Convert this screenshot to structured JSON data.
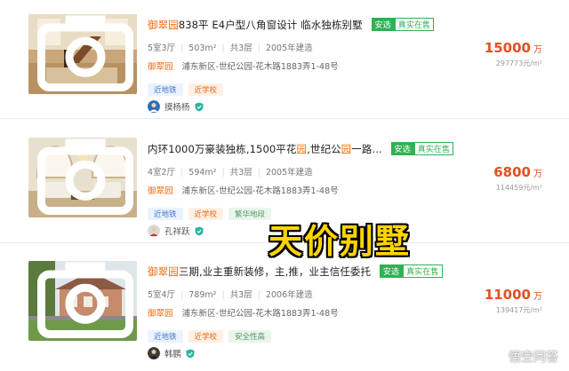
{
  "listings": [
    {
      "title_highlight": "御翠园",
      "title_rest": "838平 E4户型八角窗设计 临水独栋别墅",
      "tag_anxuan": "安选",
      "tag_real": "真实在售",
      "layout": "5室3厅",
      "area": "503m²",
      "floor": "共3层",
      "year": "2005年建造",
      "estate": "御翠园",
      "address": "浦东新区-世纪公园-花木路1883弄1-48号",
      "tags": [
        {
          "label": "近地铁",
          "color": "blue"
        },
        {
          "label": "近学校",
          "color": "orange"
        }
      ],
      "agent": "摸杨杨",
      "price": "15000",
      "price_unit": "万",
      "unit_price": "297773元/m²"
    },
    {
      "title_a": "内环1000万豪装独栋,1500平花",
      "title_hl1": "园",
      "title_b": ",世纪公",
      "title_hl2": "园",
      "title_c": "一路...",
      "tag_anxuan": "安选",
      "tag_real": "真实在售",
      "layout": "4室2厅",
      "area": "594m²",
      "floor": "共3层",
      "year": "2005年建造",
      "estate": "御翠园",
      "address": "浦东新区-世纪公园-花木路1883弄1-48号",
      "tags": [
        {
          "label": "近地铁",
          "color": "blue"
        },
        {
          "label": "近学校",
          "color": "orange"
        },
        {
          "label": "繁华地段",
          "color": "green"
        }
      ],
      "agent": "孔祥跃",
      "price": "6800",
      "price_unit": "万",
      "unit_price": "114459元/m²"
    },
    {
      "title_highlight": "御翠园",
      "title_rest": "三期,业主重新装修，主,推，业主信任委托",
      "tag_anxuan": "安选",
      "tag_real": "真实在售",
      "layout": "5室4厅",
      "area": "789m²",
      "floor": "共3层",
      "year": "2006年建造",
      "estate": "御翠园",
      "address": "浦东新区-世纪公园-花木路1883弄1-48号",
      "tags": [
        {
          "label": "近地铁",
          "color": "blue"
        },
        {
          "label": "近学校",
          "color": "orange"
        },
        {
          "label": "安全性高",
          "color": "green"
        }
      ],
      "agent": "韩鹏",
      "price": "11000",
      "price_unit": "万",
      "unit_price": "139417元/m²"
    }
  ],
  "overlay_caption": "天价别墅",
  "watermark": "悟空问答",
  "colors": {
    "accent_orange": "#f06a10",
    "price_red": "#e4501e",
    "anxuan_green": "#30b254",
    "caption_yellow": "#ffd400"
  },
  "icons": [
    "camera-icon",
    "verified-shield-icon",
    "avatar",
    "wukong-logo-icon"
  ]
}
